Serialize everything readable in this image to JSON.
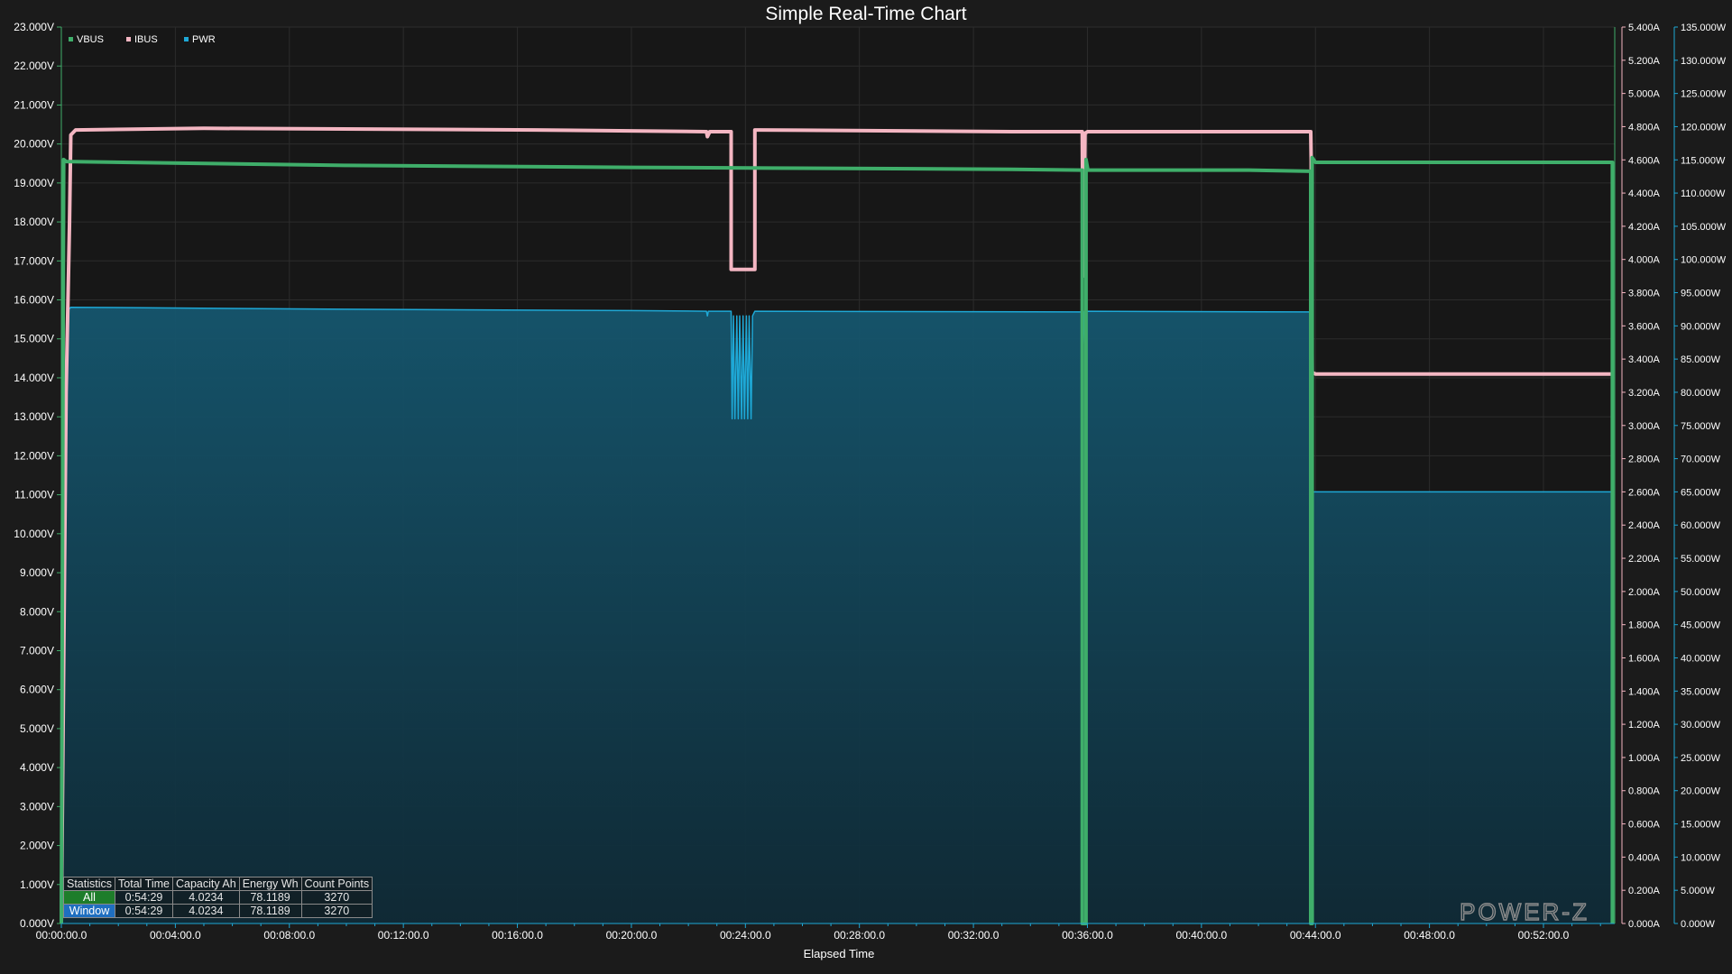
{
  "chart_data": {
    "type": "line",
    "title": "Simple Real-Time Chart",
    "xlabel": "Elapsed Time",
    "x_range_seconds": [
      0,
      3270
    ],
    "x_ticks": [
      "00:00:00.0",
      "00:04:00.0",
      "00:08:00.0",
      "00:12:00.0",
      "00:16:00.0",
      "00:20:00.0",
      "00:24:00.0",
      "00:28:00.0",
      "00:32:00.0",
      "00:36:00.0",
      "00:40:00.0",
      "00:44:00.0",
      "00:48:00.0",
      "00:52:00.0"
    ],
    "axes": {
      "voltage": {
        "range": [
          0,
          23
        ],
        "ticks": [
          "0.000V",
          "1.000V",
          "2.000V",
          "3.000V",
          "4.000V",
          "5.000V",
          "6.000V",
          "7.000V",
          "8.000V",
          "9.000V",
          "10.000V",
          "11.000V",
          "12.000V",
          "13.000V",
          "14.000V",
          "15.000V",
          "16.000V",
          "17.000V",
          "18.000V",
          "19.000V",
          "20.000V",
          "21.000V",
          "22.000V",
          "23.000V"
        ]
      },
      "current": {
        "range": [
          0,
          5.4
        ],
        "ticks": [
          "0.000A",
          "0.200A",
          "0.400A",
          "0.600A",
          "0.800A",
          "1.000A",
          "1.200A",
          "1.400A",
          "1.600A",
          "1.800A",
          "2.000A",
          "2.200A",
          "2.400A",
          "2.600A",
          "2.800A",
          "3.000A",
          "3.200A",
          "3.400A",
          "3.600A",
          "3.800A",
          "4.000A",
          "4.200A",
          "4.400A",
          "4.600A",
          "4.800A",
          "5.000A",
          "5.200A",
          "5.400A"
        ]
      },
      "power": {
        "range": [
          0,
          135
        ],
        "ticks": [
          "0.000W",
          "5.000W",
          "10.000W",
          "15.000W",
          "20.000W",
          "25.000W",
          "30.000W",
          "35.000W",
          "40.000W",
          "45.000W",
          "50.000W",
          "55.000W",
          "60.000W",
          "65.000W",
          "70.000W",
          "75.000W",
          "80.000W",
          "85.000W",
          "90.000W",
          "95.000W",
          "100.000W",
          "105.000W",
          "110.000W",
          "115.000W",
          "120.000W",
          "125.000W",
          "130.000W",
          "135.000W"
        ]
      }
    },
    "grid": true,
    "legend_position": "top-left",
    "series": [
      {
        "name": "VBUS",
        "axis": "voltage",
        "color": "#3fae6a",
        "points": [
          [
            0,
            0
          ],
          [
            5,
            19.6
          ],
          [
            10,
            19.55
          ],
          [
            600,
            19.45
          ],
          [
            1200,
            19.4
          ],
          [
            1500,
            19.38
          ],
          [
            2000,
            19.35
          ],
          [
            2149,
            19.33
          ],
          [
            2149,
            0
          ],
          [
            2157,
            0
          ],
          [
            2157,
            19.6
          ],
          [
            2161,
            19.33
          ],
          [
            2500,
            19.33
          ],
          [
            2630,
            19.3
          ],
          [
            2630,
            0
          ],
          [
            2633,
            0
          ],
          [
            2633,
            19.65
          ],
          [
            2640,
            19.53
          ],
          [
            3000,
            19.53
          ],
          [
            3265,
            19.53
          ],
          [
            3265,
            0
          ]
        ]
      },
      {
        "name": "IBUS",
        "axis": "current",
        "color": "#f4b6c2",
        "points": [
          [
            0,
            0
          ],
          [
            10,
            3.2
          ],
          [
            17,
            4.2
          ],
          [
            20,
            4.75
          ],
          [
            30,
            4.78
          ],
          [
            300,
            4.79
          ],
          [
            1000,
            4.78
          ],
          [
            1358,
            4.77
          ],
          [
            1360,
            4.74
          ],
          [
            1365,
            4.77
          ],
          [
            1410,
            4.77
          ],
          [
            1410,
            3.94
          ],
          [
            1460,
            3.94
          ],
          [
            1460,
            4.78
          ],
          [
            1470,
            4.78
          ],
          [
            2000,
            4.77
          ],
          [
            2149,
            4.77
          ],
          [
            2151,
            3.9
          ],
          [
            2153,
            4.2
          ],
          [
            2155,
            4.76
          ],
          [
            2160,
            4.77
          ],
          [
            2630,
            4.77
          ],
          [
            2631,
            4.6
          ],
          [
            2633,
            3.32
          ],
          [
            2640,
            3.31
          ],
          [
            3265,
            3.31
          ]
        ]
      },
      {
        "name": "PWR",
        "axis": "power",
        "color": "#1ea8d6",
        "points": [
          [
            0,
            0
          ],
          [
            5,
            60
          ],
          [
            10,
            80
          ],
          [
            16,
            92.5
          ],
          [
            20,
            92.8
          ],
          [
            600,
            92.5
          ],
          [
            1200,
            92.3
          ],
          [
            1358,
            92.2
          ],
          [
            1360,
            91.5
          ],
          [
            1362,
            92.2
          ],
          [
            1410,
            92.2
          ],
          [
            1412,
            76
          ],
          [
            1415,
            91.5
          ],
          [
            1418,
            76
          ],
          [
            1422,
            91.5
          ],
          [
            1425,
            76
          ],
          [
            1428,
            91.5
          ],
          [
            1432,
            76
          ],
          [
            1435,
            91.5
          ],
          [
            1438,
            76
          ],
          [
            1442,
            91.5
          ],
          [
            1445,
            76
          ],
          [
            1448,
            91.5
          ],
          [
            1452,
            76
          ],
          [
            1455,
            91.5
          ],
          [
            1460,
            92.2
          ],
          [
            2149,
            92.1
          ],
          [
            2151,
            87
          ],
          [
            2154,
            92.2
          ],
          [
            2630,
            92.1
          ],
          [
            2633,
            65
          ],
          [
            2640,
            65
          ],
          [
            3265,
            65
          ]
        ]
      }
    ],
    "statistics_table": {
      "headers": [
        "Statistics",
        "Total Time",
        "Capacity Ah",
        "Energy Wh",
        "Count Points"
      ],
      "rows": [
        {
          "label": "All",
          "values": [
            "0:54:29",
            "4.0234",
            "78.1189",
            "3270"
          ]
        },
        {
          "label": "Window",
          "values": [
            "0:54:29",
            "4.0234",
            "78.1189",
            "3270"
          ]
        }
      ]
    },
    "watermark": "POWER-Z"
  }
}
